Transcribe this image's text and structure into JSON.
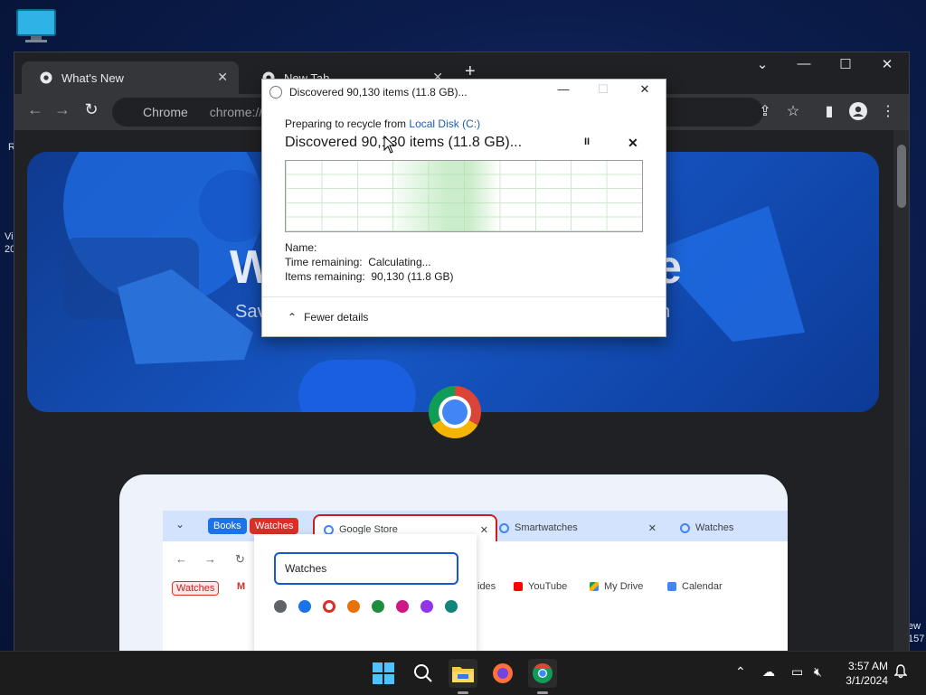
{
  "desktop": {
    "clip_left_1": "R",
    "clip_left_2": "Vi",
    "clip_left_3": "20",
    "clip_right_1": "ew",
    "clip_right_2": "157"
  },
  "browser": {
    "tabs": [
      {
        "label": "What's New",
        "active": true
      },
      {
        "label": "New Tab",
        "active": false
      }
    ],
    "new_tab_symbol": "+",
    "omnibox_chip": "Chrome",
    "omnibox_url": "chrome://w",
    "nav": {
      "back": "←",
      "forward": "→",
      "reload": "↻"
    },
    "window_controls": {
      "tab_search": "⌄",
      "minimize": "—",
      "maximize": "☐",
      "close": "✕"
    }
  },
  "hero": {
    "title_left": "W",
    "title_right": "e",
    "subtitle_left": "Sav",
    "subtitle_right": "n"
  },
  "illustration": {
    "groups": [
      {
        "label": "Books",
        "color": "#1a73e8"
      },
      {
        "label": "Watches",
        "color": "#d93025"
      }
    ],
    "tabs": [
      "Google Store",
      "Smartwatches",
      "Watches"
    ],
    "bookmarks": [
      "Watches",
      "ides",
      "YouTube",
      "My Drive",
      "Calendar"
    ],
    "popup_input": "Watches",
    "swatches": [
      "#5f6368",
      "#1a73e8",
      "#d93025",
      "#e8710a",
      "#1e8e3e",
      "#d01884",
      "#9334e6",
      "#12857a"
    ]
  },
  "dialog": {
    "title": "Discovered 90,130 items (11.8 GB)...",
    "preparing_prefix": "Preparing to recycle from ",
    "preparing_source": "Local Disk (C:)",
    "status": "Discovered 90,130 items (11.8 GB)...",
    "name_label": "Name:",
    "time_label": "Time remaining:",
    "time_value": "Calculating...",
    "items_label": "Items remaining:",
    "items_value": "90,130 (11.8 GB)",
    "fewer_details": "Fewer details",
    "pause_symbol": "II",
    "cancel_symbol": "✕"
  },
  "taskbar": {
    "time": "3:57 AM",
    "date": "3/1/2024"
  }
}
